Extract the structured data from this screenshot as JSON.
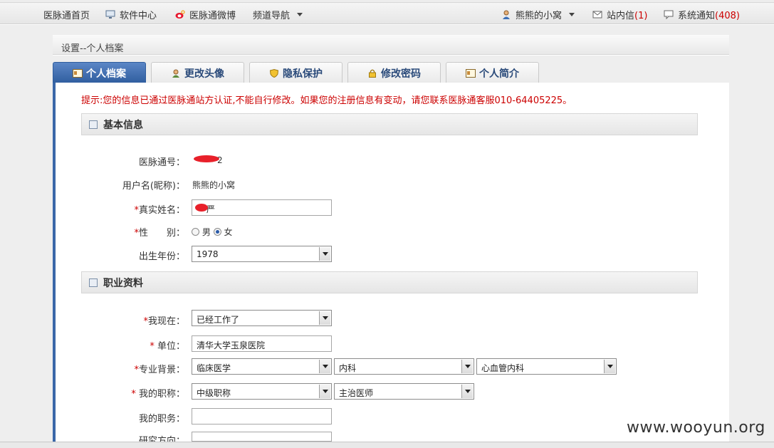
{
  "topnav": {
    "home": "医脉通首页",
    "software": "软件中心",
    "weibo": "医脉通微博",
    "channel": "频道导航",
    "user": "熊熊的小窝",
    "messages_label": "站内信",
    "messages_count": "(1)",
    "notify_label": "系统通知",
    "notify_count": "(408)"
  },
  "breadcrumb": "设置--个人档案",
  "tabs": [
    {
      "label": "个人档案"
    },
    {
      "label": "更改头像"
    },
    {
      "label": "隐私保护"
    },
    {
      "label": "修改密码"
    },
    {
      "label": "个人简介"
    }
  ],
  "notice": "提示:您的信息已通过医脉通站方认证,不能自行修改。如果您的注册信息有变动，请您联系医脉通客服010-64405225。",
  "basic": {
    "title": "基本信息",
    "id_label": "医脉通号：",
    "id_value": "2",
    "username_label": "用户名(昵称)：",
    "username_value": "熊熊的小窝",
    "realname_label": "真实姓名：",
    "realname_value": "严",
    "gender_label": "性　　别：",
    "gender_male": "男",
    "gender_female": "女",
    "birth_label": "出生年份：",
    "birth_value": "1978"
  },
  "career": {
    "title": "职业资料",
    "status_label": "我现在：",
    "status_value": "已经工作了",
    "unit_label": "单位：",
    "unit_value": "清华大学玉泉医院",
    "major_label": "专业背景：",
    "major_1": "临床医学",
    "major_2": "内科",
    "major_3": "心血管内科",
    "title_label": "我的职称：",
    "title_1": "中级职称",
    "title_2": "主治医师",
    "duty_label": "我的职务：",
    "duty_value": "",
    "research_label": "研究方向："
  },
  "watermark": "www.wooyun.org"
}
